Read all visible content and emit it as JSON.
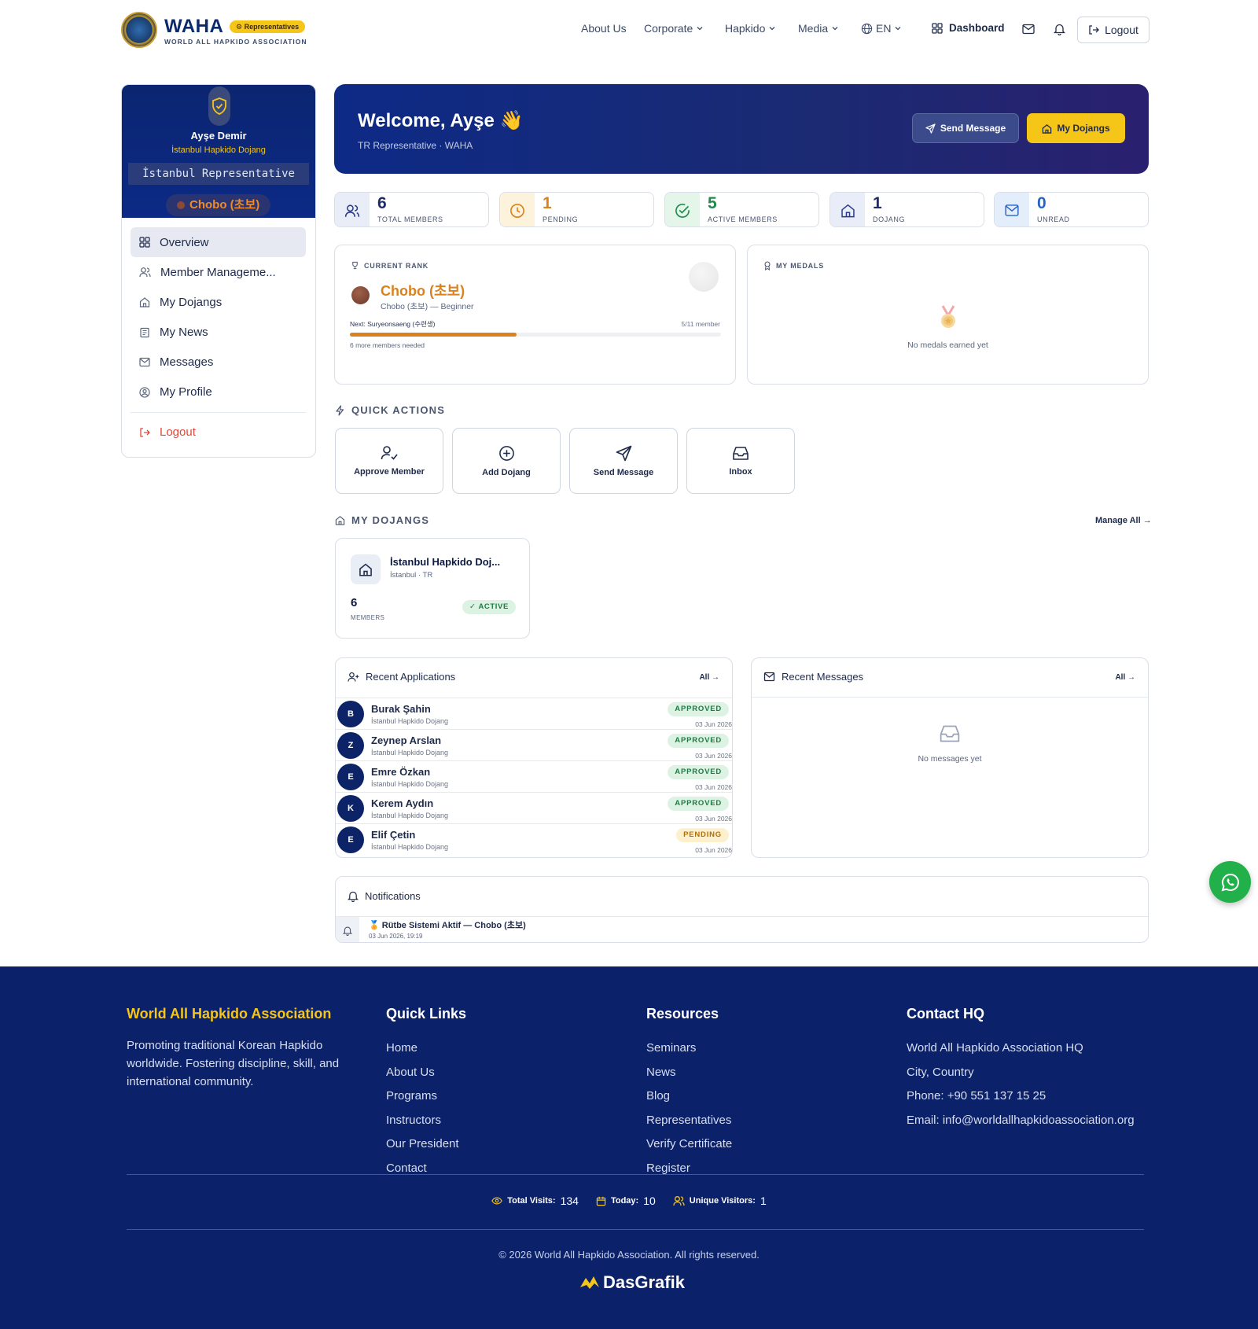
{
  "brand": {
    "name": "WAHA",
    "badge": "⚙ Representatives",
    "subtitle": "WORLD ALL HAPKIDO ASSOCIATION"
  },
  "nav": {
    "about": "About Us",
    "corporate": "Corporate",
    "hapkido": "Hapkido",
    "media": "Media",
    "lang": "EN",
    "dashboard": "Dashboard",
    "logout": "Logout"
  },
  "sidebar": {
    "name": "Ayşe Demir",
    "dojang": "İstanbul Hapkido Dojang",
    "role": "İstanbul Representative",
    "rank": "Chobo (초보)",
    "items": [
      {
        "label": "Overview",
        "icon": "grid-icon"
      },
      {
        "label": "Member Manageme...",
        "icon": "users-icon"
      },
      {
        "label": "My Dojangs",
        "icon": "home-icon"
      },
      {
        "label": "My News",
        "icon": "newspaper-icon"
      },
      {
        "label": "Messages",
        "icon": "mail-icon"
      },
      {
        "label": "My Profile",
        "icon": "user-circle-icon"
      }
    ],
    "logout": "Logout"
  },
  "welcome": {
    "title": "Welcome, Ayşe 👋",
    "subtitle": "TR Representative · WAHA",
    "send_message": "Send Message",
    "my_dojangs": "My Dojangs"
  },
  "stats": [
    {
      "value": "6",
      "label": "TOTAL MEMBERS",
      "color": "#1e2a6a",
      "bg": "#e8edf8"
    },
    {
      "value": "1",
      "label": "PENDING",
      "color": "#d9821e",
      "bg": "#fdf3dc"
    },
    {
      "value": "5",
      "label": "ACTIVE MEMBERS",
      "color": "#1f8a4c",
      "bg": "#e4f5ea"
    },
    {
      "value": "1",
      "label": "DOJANG",
      "color": "#1e2a6a",
      "bg": "#e8edf8"
    },
    {
      "value": "0",
      "label": "UNREAD",
      "color": "#2563c9",
      "bg": "#e4eefb"
    }
  ],
  "rank_card": {
    "heading": "CURRENT RANK",
    "rank": "Chobo (초보)",
    "sub": "Chobo (초보) — Beginner",
    "next": "Next: Suryeonsaeng (수련생)",
    "count": "5/11 member",
    "progress": 0.45,
    "needed": "6 more members needed"
  },
  "medals": {
    "heading": "MY MEDALS",
    "empty": "No medals earned yet"
  },
  "quick_actions": {
    "heading": "QUICK ACTIONS",
    "items": [
      {
        "label": "Approve Member"
      },
      {
        "label": "Add Dojang"
      },
      {
        "label": "Send Message"
      },
      {
        "label": "Inbox"
      }
    ]
  },
  "my_dojangs": {
    "heading": "MY DOJANGS",
    "manage_all": "Manage All →",
    "card": {
      "name": "İstanbul Hapkido Doj...",
      "location": "İstanbul · TR",
      "members": "6",
      "members_label": "MEMBERS",
      "status": "✓ ACTIVE"
    }
  },
  "applications": {
    "heading": "Recent Applications",
    "all": "All →",
    "rows": [
      {
        "initial": "B",
        "name": "Burak Şahin",
        "dojang": "İstanbul Hapkido Dojang",
        "status": "APPROVED",
        "date": "03 Jun 2026"
      },
      {
        "initial": "Z",
        "name": "Zeynep Arslan",
        "dojang": "İstanbul Hapkido Dojang",
        "status": "APPROVED",
        "date": "03 Jun 2026"
      },
      {
        "initial": "E",
        "name": "Emre Özkan",
        "dojang": "İstanbul Hapkido Dojang",
        "status": "APPROVED",
        "date": "03 Jun 2026"
      },
      {
        "initial": "K",
        "name": "Kerem Aydın",
        "dojang": "İstanbul Hapkido Dojang",
        "status": "APPROVED",
        "date": "03 Jun 2026"
      },
      {
        "initial": "E",
        "name": "Elif Çetin",
        "dojang": "İstanbul Hapkido Dojang",
        "status": "PENDING",
        "date": "03 Jun 2026"
      }
    ]
  },
  "messages": {
    "heading": "Recent Messages",
    "all": "All →",
    "empty": "No messages yet"
  },
  "notifications": {
    "heading": "Notifications",
    "items": [
      {
        "title": "🏅 Rütbe Sistemi Aktif — Chobo (초보)",
        "time": "03 Jun 2026, 19:19"
      }
    ]
  },
  "footer": {
    "about_title": "World All Hapkido Association",
    "about_text": "Promoting traditional Korean Hapkido worldwide. Fostering discipline, skill, and international community.",
    "quick_title": "Quick Links",
    "quick_links": [
      "Home",
      "About Us",
      "Programs",
      "Instructors",
      "Our President",
      "Contact"
    ],
    "res_title": "Resources",
    "res_links": [
      "Seminars",
      "News",
      "Blog",
      "Representatives",
      "Verify Certificate",
      "Register"
    ],
    "contact_title": "Contact HQ",
    "contact_lines": [
      "World All Hapkido Association HQ",
      "City, Country",
      "Phone: +90 551 137 15 25",
      "Email: info@worldallhapkidoassociation.org"
    ],
    "total_visits_label": "Total Visits:",
    "total_visits": "134",
    "today_label": "Today:",
    "today": "10",
    "unique_label": "Unique Visitors:",
    "unique": "1",
    "copyright": "© 2026 World All Hapkido Association. All rights reserved.",
    "credit": "DasGrafik"
  },
  "colors": {
    "navy": "#0b226b",
    "gold": "#f5c518",
    "accent_orange": "#d9821e",
    "danger": "#e0483a"
  }
}
